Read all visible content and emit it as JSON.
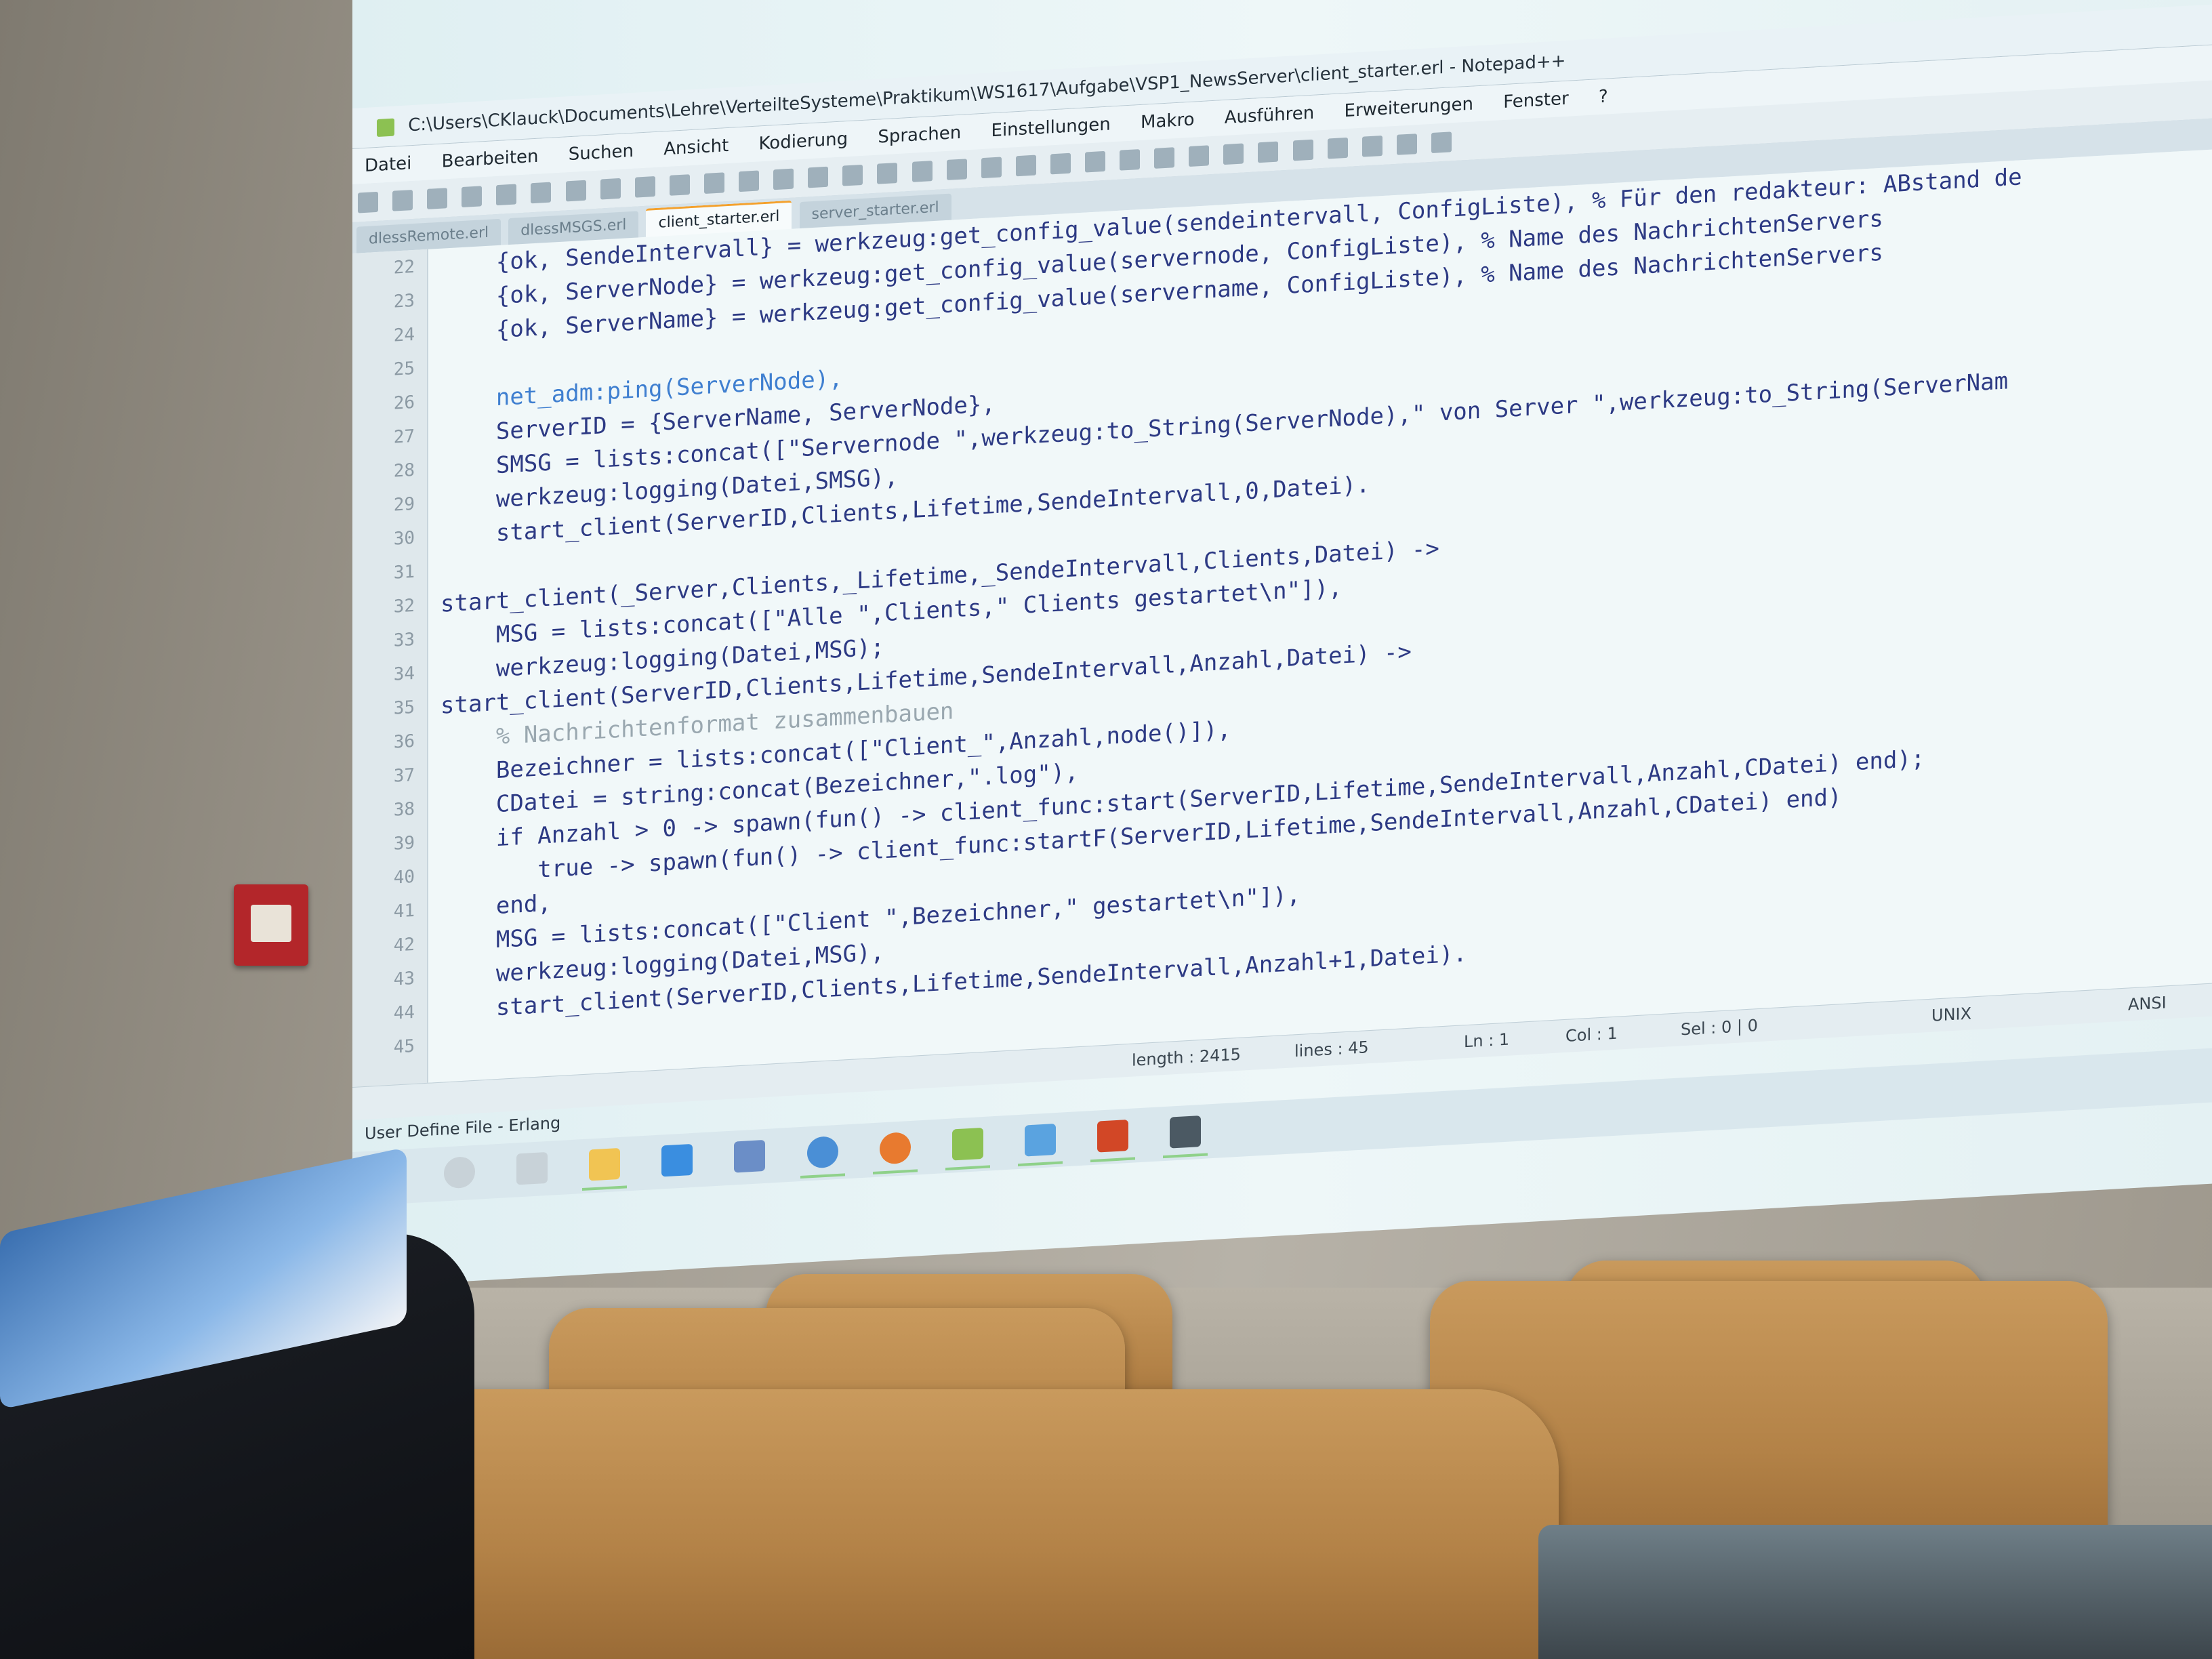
{
  "window": {
    "title": "C:\\Users\\CKlauck\\Documents\\Lehre\\VerteilteSysteme\\Praktikum\\WS1617\\Aufgabe\\VSP1_NewsServer\\client_starter.erl - Notepad++"
  },
  "menu": [
    "Datei",
    "Bearbeiten",
    "Suchen",
    "Ansicht",
    "Kodierung",
    "Sprachen",
    "Einstellungen",
    "Makro",
    "Ausführen",
    "Erweiterungen",
    "Fenster",
    "?"
  ],
  "tabs": [
    {
      "label": "dlessRemote.erl",
      "active": false
    },
    {
      "label": "dlessMSGS.erl",
      "active": false
    },
    {
      "label": "client_starter.erl",
      "active": true
    },
    {
      "label": "server_starter.erl",
      "active": false
    }
  ],
  "code": {
    "header_lines": [
      "{ok, SendeIntervall} = werkzeug:get_config_value(sendeintervall, ConfigListe), % Für den redakteur: ABstand de",
      "{ok, ServerNode} = werkzeug:get_config_value(servernode, ConfigListe), % Name des NachrichtenServers",
      "{ok, ServerName} = werkzeug:get_config_value(servername, ConfigListe), % Name des NachrichtenServers"
    ],
    "lines": [
      {
        "n": "22",
        "text": "    {ok, SendeIntervall} = werkzeug:get_config_value(sendeintervall, ConfigListe), % Für den redakteur: ABstand de"
      },
      {
        "n": "23",
        "text": "    {ok, ServerNode} = werkzeug:get_config_value(servernode, ConfigListe), % Name des NachrichtenServers"
      },
      {
        "n": "24",
        "text": "    {ok, ServerName} = werkzeug:get_config_value(servername, ConfigListe), % Name des NachrichtenServers"
      },
      {
        "n": "25",
        "text": ""
      },
      {
        "n": "26",
        "text": "    net_adm:ping(ServerNode),"
      },
      {
        "n": "27",
        "text": "    ServerID = {ServerName, ServerNode},"
      },
      {
        "n": "28",
        "text": "    SMSG = lists:concat([\"Servernode \",werkzeug:to_String(ServerNode),\" von Server \",werkzeug:to_String(ServerNam"
      },
      {
        "n": "29",
        "text": "    werkzeug:logging(Datei,SMSG),"
      },
      {
        "n": "30",
        "text": "    start_client(ServerID,Clients,Lifetime,SendeIntervall,0,Datei)."
      },
      {
        "n": "31",
        "text": ""
      },
      {
        "n": "32",
        "text": "start_client(_Server,Clients,_Lifetime,_SendeIntervall,Clients,Datei) ->"
      },
      {
        "n": "33",
        "text": "    MSG = lists:concat([\"Alle \",Clients,\" Clients gestartet\\n\"]),"
      },
      {
        "n": "34",
        "text": "    werkzeug:logging(Datei,MSG);"
      },
      {
        "n": "35",
        "text": "start_client(ServerID,Clients,Lifetime,SendeIntervall,Anzahl,Datei) ->"
      },
      {
        "n": "36",
        "text": "    % Nachrichtenformat zusammenbauen"
      },
      {
        "n": "37",
        "text": "    Bezeichner = lists:concat([\"Client_\",Anzahl,node()]),"
      },
      {
        "n": "38",
        "text": "    CDatei = string:concat(Bezeichner,\".log\"),"
      },
      {
        "n": "39",
        "text": "    if Anzahl > 0 -> spawn(fun() -> client_func:start(ServerID,Lifetime,SendeIntervall,Anzahl,CDatei) end);"
      },
      {
        "n": "40",
        "text": "       true -> spawn(fun() -> client_func:startF(ServerID,Lifetime,SendeIntervall,Anzahl,CDatei) end)"
      },
      {
        "n": "41",
        "text": "    end,"
      },
      {
        "n": "42",
        "text": "    MSG = lists:concat([\"Client \",Bezeichner,\" gestartet\\n\"]),"
      },
      {
        "n": "43",
        "text": "    werkzeug:logging(Datei,MSG),"
      },
      {
        "n": "44",
        "text": "    start_client(ServerID,Clients,Lifetime,SendeIntervall,Anzahl+1,Datei)."
      },
      {
        "n": "45",
        "text": ""
      }
    ]
  },
  "status": {
    "length": "length : 2415",
    "lines": "lines : 45",
    "ln": "Ln : 1",
    "col": "Col : 1",
    "sel": "Sel : 0 | 0",
    "eol": "UNIX",
    "encoding": "ANSI"
  },
  "language": "User Define File - Erlang",
  "taskbar_icons": [
    "windows-start-icon",
    "cortana-icon",
    "task-view-icon",
    "file-explorer-icon",
    "people-icon",
    "erlang-icon",
    "chrome-icon",
    "firefox-icon",
    "notepadpp-icon",
    "notepad-icon",
    "powerpoint-icon",
    "cmd-icon"
  ]
}
